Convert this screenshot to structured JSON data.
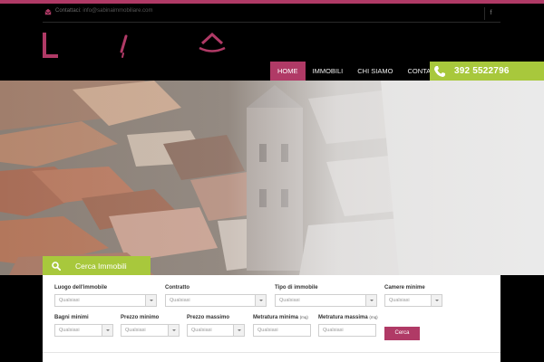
{
  "topbar": {
    "contact_label": "Contattaci:",
    "contact_email": "info@sabinaimmobiliare.com"
  },
  "colors": {
    "brand_magenta": "#b03a66",
    "brand_green": "#a8c83c"
  },
  "icons": {
    "mail": "envelope-icon",
    "social": "facebook-icon",
    "phone": "phone-icon",
    "search": "magnifier-icon"
  },
  "nav": {
    "items": [
      {
        "label": "HOME",
        "active": true
      },
      {
        "label": "IMMOBILI",
        "active": false
      },
      {
        "label": "CHI SIAMO",
        "active": false
      },
      {
        "label": "CONTATTI",
        "active": false
      }
    ],
    "phone": "392 5522796"
  },
  "search": {
    "tab_label": "Cerca Immobili",
    "location": {
      "label": "Luogo dell'immobile",
      "value": "Qualsiasi"
    },
    "contract": {
      "label": "Contratto",
      "value": "Qualsiasi"
    },
    "type": {
      "label": "Tipo di immobile",
      "value": "Qualsiasi"
    },
    "rooms_min": {
      "label": "Camere minime",
      "value": "Qualsiasi"
    },
    "baths_min": {
      "label": "Bagni minimi",
      "value": "Qualsiasi"
    },
    "price_min": {
      "label": "Prezzo minimo",
      "value": "Qualsiasi"
    },
    "price_max": {
      "label": "Prezzo massimo",
      "value": "Qualsiasi"
    },
    "area_min": {
      "label": "Metratura minima",
      "unit": "(mq)",
      "placeholder": "Qualsiasi"
    },
    "area_max": {
      "label": "Metratura massima",
      "unit": "(mq)",
      "placeholder": "Qualsiasi"
    },
    "submit_label": "Cerca"
  }
}
